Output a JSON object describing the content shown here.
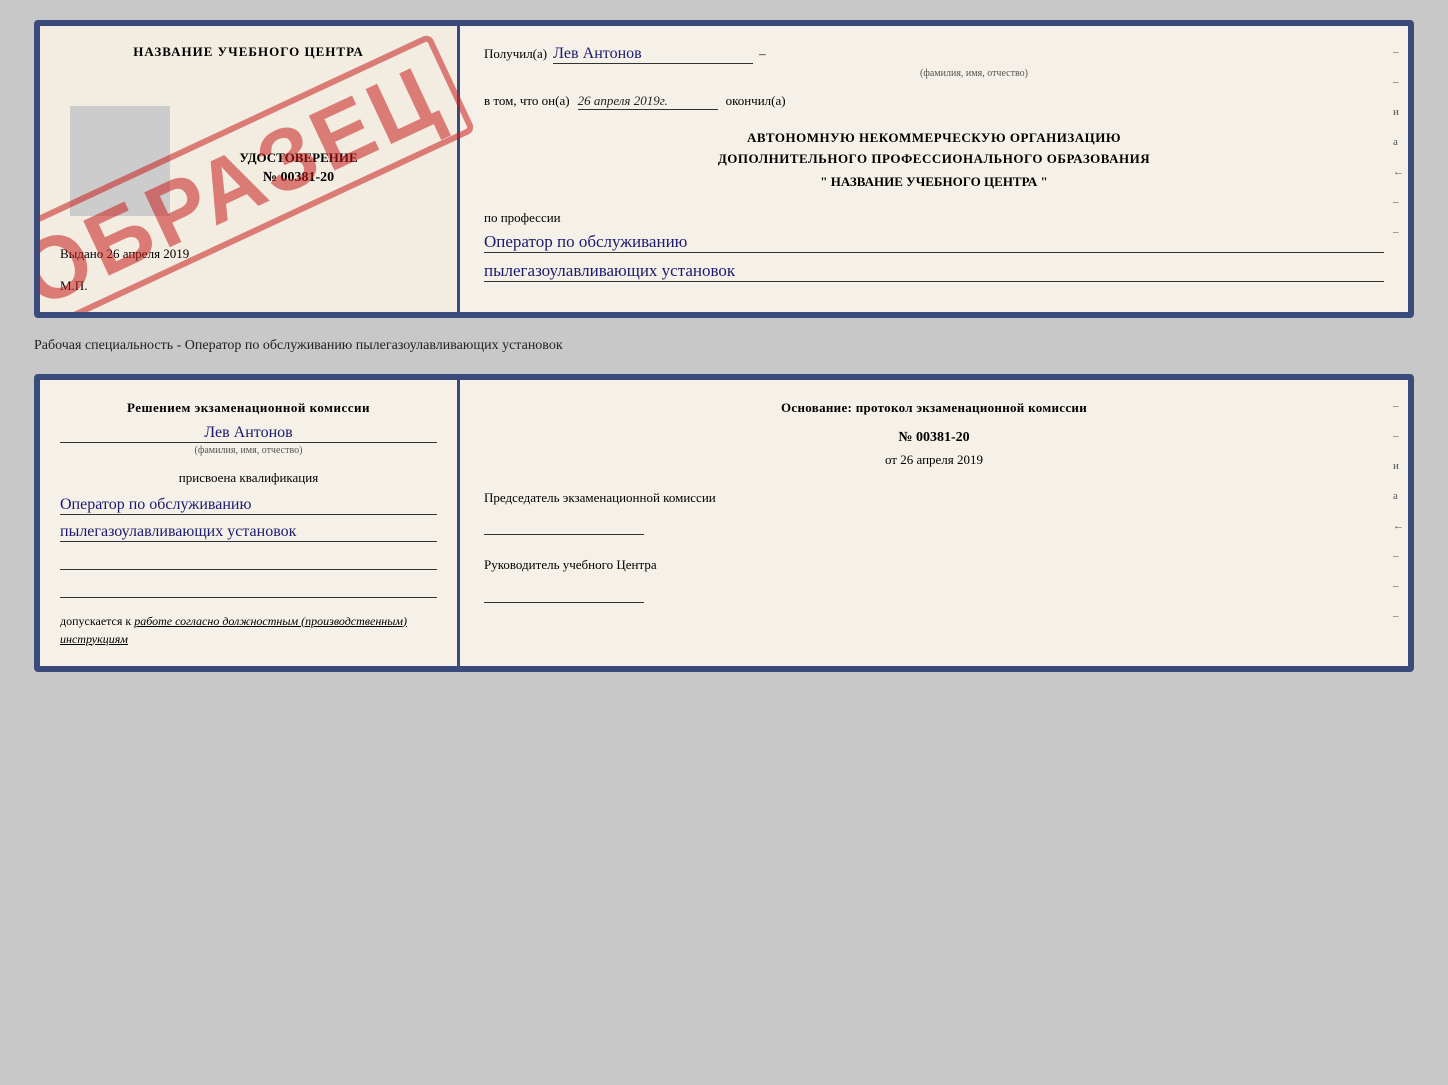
{
  "page": {
    "bg_color": "#c8c8c8"
  },
  "top_section": {
    "left": {
      "center_title": "НАЗВАНИЕ УЧЕБНОГО ЦЕНТРА",
      "udostoverenie_label": "УДОСТОВЕРЕНИЕ",
      "number": "№ 00381-20",
      "vydano_label": "Выдано",
      "vydano_date": "26 апреля 2019",
      "mp_label": "М.П.",
      "obrazec": "ОБРАЗЕЦ"
    },
    "right": {
      "poluchil_label": "Получил(а)",
      "recipient_name": "Лев Антонов",
      "fio_hint": "(фамилия, имя, отчество)",
      "dash": "–",
      "vtom_label": "в том, что он(а)",
      "vtom_date": "26 апреля 2019г.",
      "okonchill_label": "окончил(а)",
      "org_line1": "АВТОНОМНУЮ НЕКОММЕРЧЕСКУЮ ОРГАНИЗАЦИЮ",
      "org_line2": "ДОПОЛНИТЕЛЬНОГО ПРОФЕССИОНАЛЬНОГО ОБРАЗОВАНИЯ",
      "org_quote": "\"   НАЗВАНИЕ УЧЕБНОГО ЦЕНТРА   \"",
      "po_professii_label": "по профессии",
      "profession_line1": "Оператор по обслуживанию",
      "profession_line2": "пылегазоулавливающих установок"
    }
  },
  "separator": {
    "text": "Рабочая специальность - Оператор по обслуживанию пылегазоулавливающих установок"
  },
  "bottom_section": {
    "left": {
      "resheniem_label": "Решением экзаменационной комиссии",
      "name": "Лев Антонов",
      "fio_hint": "(фамилия, имя, отчество)",
      "prisvoena_label": "присвоена квалификация",
      "profession_line1": "Оператор по обслуживанию",
      "profession_line2": "пылегазоулавливающих установок",
      "dopuskaetsya_label": "допускается к",
      "dopusk_text": "работе согласно должностным (производственным) инструкциям"
    },
    "right": {
      "osnovanie_label": "Основание: протокол экзаменационной комиссии",
      "protocol_number": "№  00381-20",
      "ot_label": "от",
      "ot_date": "26 апреля 2019",
      "predsedatel_label": "Председатель экзаменационной комиссии",
      "rukovoditel_label": "Руководитель учебного Центра"
    }
  },
  "side_marks": {
    "marks": [
      "–",
      "–",
      "и",
      "а",
      "←",
      "–",
      "–",
      "–",
      "–"
    ]
  }
}
